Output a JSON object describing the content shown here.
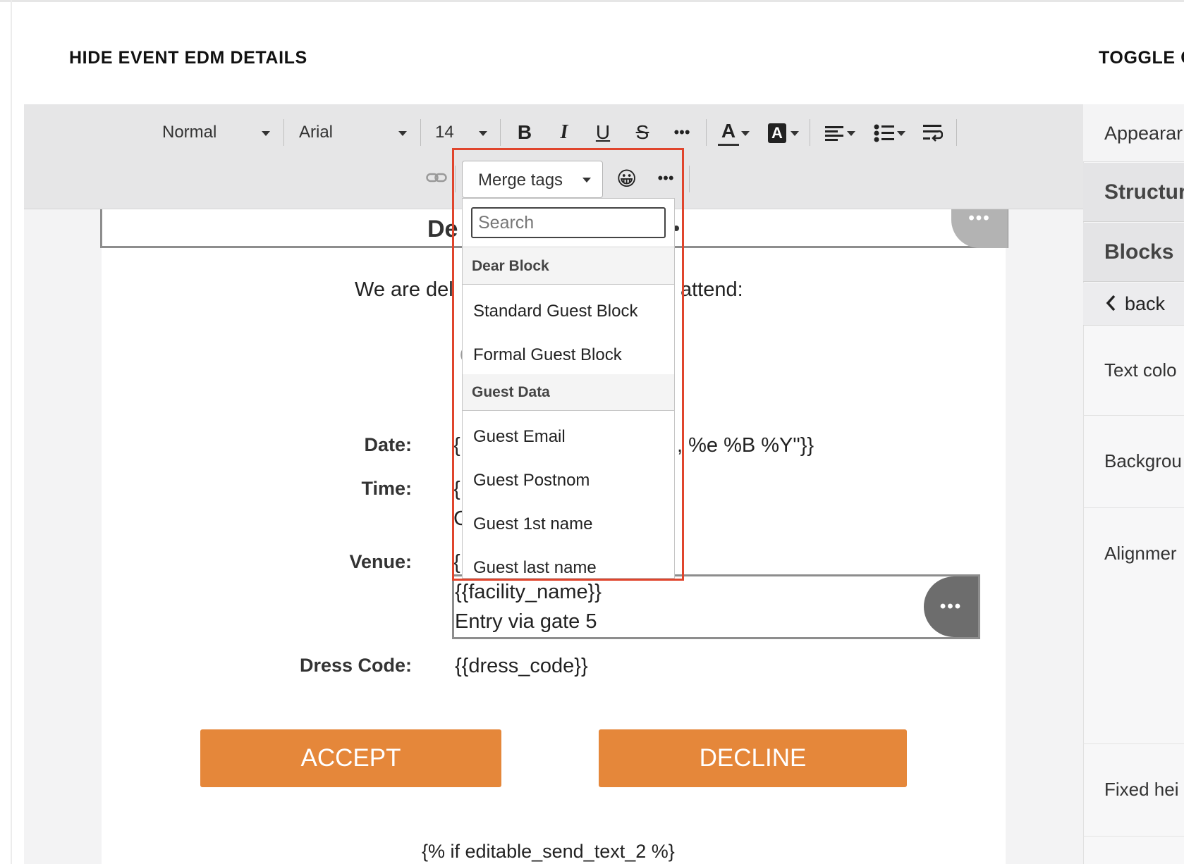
{
  "header": {
    "left_action": "HIDE EVENT EDM DETAILS",
    "right_action": "TOGGLE C"
  },
  "toolbar": {
    "paragraph_style": "Normal",
    "font_family": "Arial",
    "font_size": "14",
    "bold": "B",
    "italic": "I",
    "underline": "U",
    "strike": "S",
    "more": "•••",
    "text_color": "A",
    "highlight": "A",
    "emoji": "😀",
    "merge_tags_label": "Merge tags"
  },
  "merge_dropdown": {
    "search_placeholder": "Search",
    "groups": [
      {
        "title": "Dear Block",
        "items": [
          "Standard Guest Block",
          "Formal Guest Block"
        ]
      },
      {
        "title": "Guest Data",
        "items": [
          "Guest Email",
          "Guest Postnom",
          "Guest 1st name",
          "Guest last name"
        ]
      }
    ]
  },
  "document": {
    "heading_fragment": "De",
    "intro_left": "We are del",
    "intro_right": "attend:",
    "fields": [
      {
        "label": "Date:",
        "value_left": "{",
        "value_right": ", %e %B %Y\"}}"
      },
      {
        "label": "Time:",
        "value_left": "{",
        "value_line2": "C"
      },
      {
        "label": "Venue:",
        "value_left": "{",
        "lines": [
          "{{facility_name}}",
          "Entry via gate 5"
        ]
      },
      {
        "label": "Dress Code:",
        "value": "{{dress_code}}"
      }
    ],
    "accept_label": "ACCEPT",
    "decline_label": "DECLINE",
    "footer_code": "{% if editable_send_text_2 %}",
    "dots": "•••"
  },
  "right_panel": {
    "tabs": [
      "Appearar",
      "Structur",
      "Blocks"
    ],
    "back_label": "back",
    "properties": [
      "Text colo",
      "Backgrou",
      "Alignmer",
      "Fixed hei"
    ]
  },
  "colors": {
    "accent_orange": "#e5873a",
    "highlight_red": "#e0452d",
    "toolbar_gray": "#e6e6e7"
  }
}
